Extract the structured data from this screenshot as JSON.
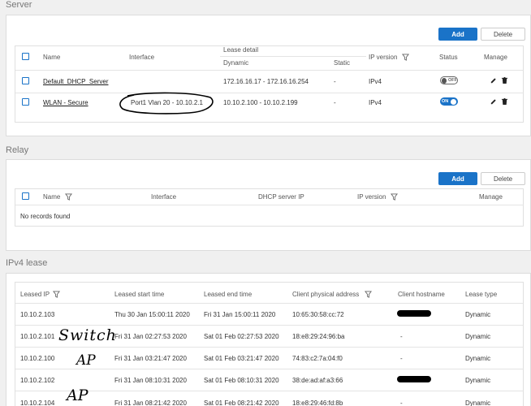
{
  "server": {
    "title": "Server",
    "add_label": "Add",
    "delete_label": "Delete",
    "headers": {
      "name": "Name",
      "interface": "Interface",
      "lease_detail": "Lease detail",
      "dynamic": "Dynamic",
      "static": "Static",
      "ip_version": "IP version",
      "status": "Status",
      "manage": "Manage"
    },
    "rows": [
      {
        "name": "Default_DHCP_Server",
        "interface": "",
        "dynamic": "172.16.16.17 - 172.16.16.254",
        "static": "-",
        "ip_version": "IPv4",
        "status": "OFF"
      },
      {
        "name": "WLAN - Secure",
        "interface": "Port1 Vlan 20 - 10.10.2.1",
        "dynamic": "10.10.2.100 - 10.10.2.199",
        "static": "-",
        "ip_version": "IPv4",
        "status": "ON"
      }
    ]
  },
  "relay": {
    "title": "Relay",
    "add_label": "Add",
    "delete_label": "Delete",
    "headers": {
      "name": "Name",
      "interface": "Interface",
      "dhcp_server_ip": "DHCP server IP",
      "ip_version": "IP version",
      "manage": "Manage"
    },
    "empty_text": "No records found"
  },
  "lease": {
    "title": "IPv4 lease",
    "headers": {
      "leased_ip": "Leased IP",
      "start": "Leased start time",
      "end": "Leased end time",
      "mac": "Client physical address",
      "hostname": "Client hostname",
      "type": "Lease type"
    },
    "rows": [
      {
        "ip": "10.10.2.103",
        "start": "Thu 30 Jan 15:00:11 2020",
        "end": "Fri 31 Jan 15:00:11 2020",
        "mac": "10:65:30:58:cc:72",
        "hostname": "",
        "type": "Dynamic"
      },
      {
        "ip": "10.10.2.101",
        "start": "Fri 31 Jan 02:27:53 2020",
        "end": "Sat 01 Feb 02:27:53 2020",
        "mac": "18:e8:29:24:96:ba",
        "hostname": "-",
        "type": "Dynamic"
      },
      {
        "ip": "10.10.2.100",
        "start": "Fri 31 Jan 03:21:47 2020",
        "end": "Sat 01 Feb 03:21:47 2020",
        "mac": "74:83:c2:7a:04:f0",
        "hostname": "-",
        "type": "Dynamic"
      },
      {
        "ip": "10.10.2.102",
        "start": "Fri 31 Jan 08:10:31 2020",
        "end": "Sat 01 Feb 08:10:31 2020",
        "mac": "38:de:ad:af:a3:66",
        "hostname": "",
        "type": "Dynamic"
      },
      {
        "ip": "10.10.2.104",
        "start": "Fri 31 Jan 08:21:42 2020",
        "end": "Sat 01 Feb 08:21:42 2020",
        "mac": "18:e8:29:46:fd:8b",
        "hostname": "-",
        "type": "Dynamic"
      }
    ]
  },
  "annotations": {
    "switch": "Switch",
    "ap1": "AP",
    "ap2": "AP"
  },
  "colors": {
    "accent": "#1a73c8",
    "background": "#f0f0f0"
  }
}
